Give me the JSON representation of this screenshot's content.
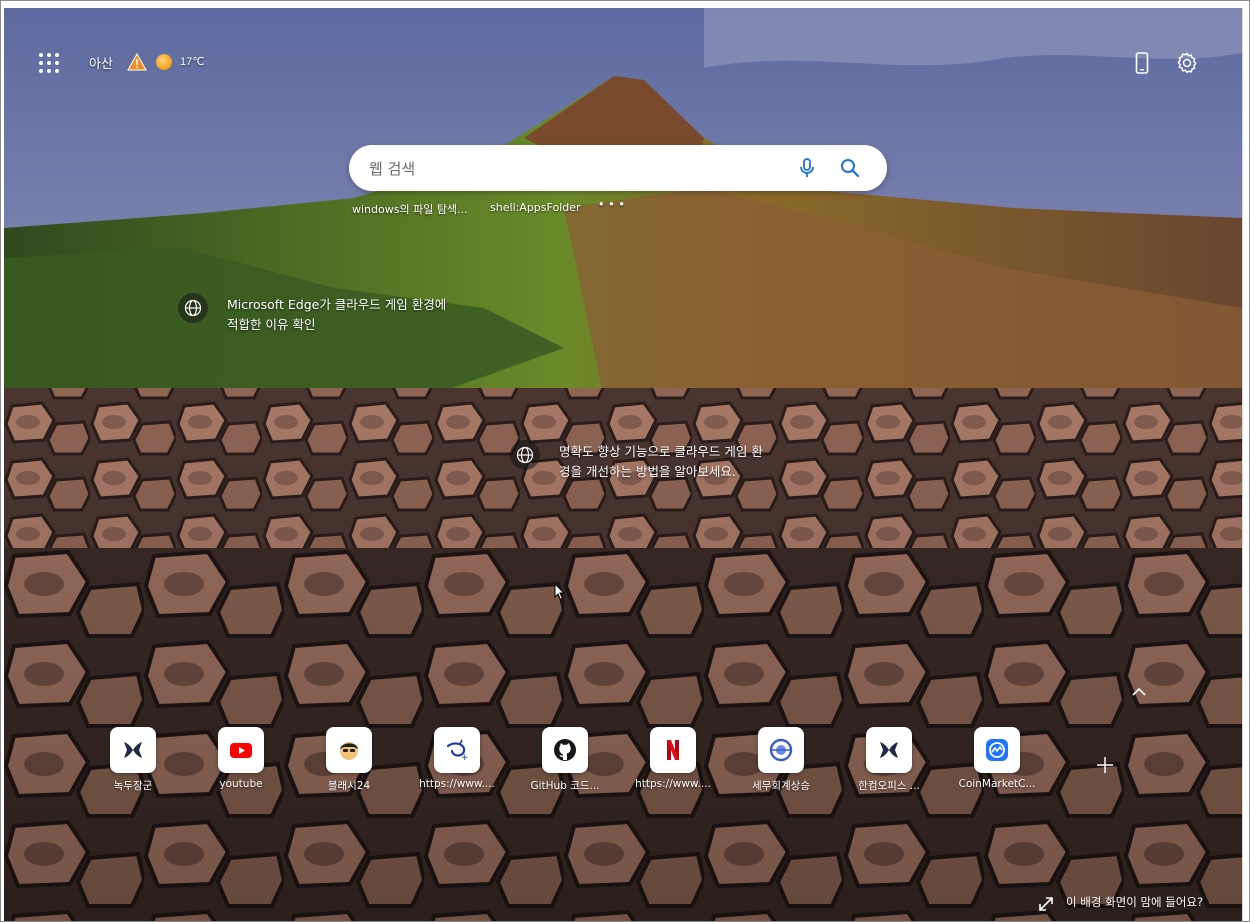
{
  "header": {
    "location": "아산",
    "temperature": "17℃",
    "weather_icon": "sun-icon",
    "alert_icon": "warning-icon"
  },
  "search": {
    "placeholder": "웹 검색",
    "history": [
      "windows의 파일 탐색...",
      "shell:AppsFolder"
    ],
    "more": "• • •"
  },
  "cards": [
    {
      "line1": "Microsoft Edge가 클라우드 게임 환경에",
      "line2": "적합한 이유 확인"
    },
    {
      "line1": "명확도 향상 기능으로 클라우드 게임 환",
      "line2": "경을 개선하는 방법을 알아보세요."
    }
  ],
  "quick_links": [
    {
      "label": "녹두장군",
      "icon": "app-x-icon",
      "color": "#1f2a44"
    },
    {
      "label": "youtube",
      "icon": "youtube-icon",
      "color": "#ff0000"
    },
    {
      "label": "블래시24",
      "icon": "avatar-icon",
      "color": "#222222"
    },
    {
      "label": "https://www....",
      "icon": "disney-plus-icon",
      "color": "#1b3aa6"
    },
    {
      "label": "GitHub 코드...",
      "icon": "github-icon",
      "color": "#181717"
    },
    {
      "label": "https://www....",
      "icon": "netflix-icon",
      "color": "#e50914"
    },
    {
      "label": "세무회계상승",
      "icon": "app-circle-icon",
      "color": "#3b5bc4"
    },
    {
      "label": "한컴오피스 ...",
      "icon": "app-x-icon",
      "color": "#1f2a44"
    },
    {
      "label": "CoinMarketC...",
      "icon": "coinmarketcap-icon",
      "color": "#1e74ff"
    }
  ],
  "footer": {
    "text": "이 배경 화면이 맘에 들어요?"
  }
}
